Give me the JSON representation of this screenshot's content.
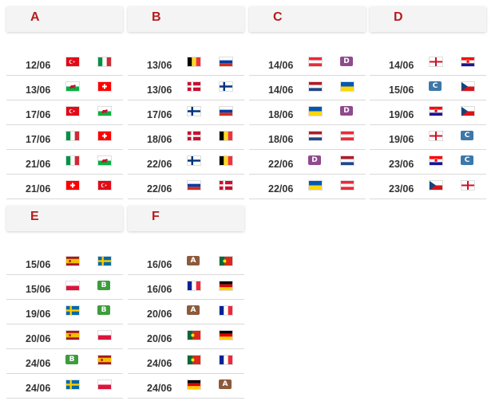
{
  "groups": [
    {
      "letter": "A",
      "matches": [
        {
          "date": "12/06",
          "t1": "turkey",
          "t2": "italy"
        },
        {
          "date": "13/06",
          "t1": "wales",
          "t2": "switzerland"
        },
        {
          "date": "17/06",
          "t1": "turkey",
          "t2": "wales"
        },
        {
          "date": "17/06",
          "t1": "italy",
          "t2": "switzerland"
        },
        {
          "date": "21/06",
          "t1": "italy",
          "t2": "wales"
        },
        {
          "date": "21/06",
          "t1": "switzerland",
          "t2": "turkey"
        }
      ]
    },
    {
      "letter": "B",
      "matches": [
        {
          "date": "13/06",
          "t1": "belgium",
          "t2": "russia"
        },
        {
          "date": "13/06",
          "t1": "denmark",
          "t2": "finland"
        },
        {
          "date": "17/06",
          "t1": "finland",
          "t2": "russia"
        },
        {
          "date": "18/06",
          "t1": "denmark",
          "t2": "belgium"
        },
        {
          "date": "22/06",
          "t1": "finland",
          "t2": "belgium"
        },
        {
          "date": "22/06",
          "t1": "russia",
          "t2": "denmark"
        }
      ]
    },
    {
      "letter": "C",
      "matches": [
        {
          "date": "14/06",
          "t1": "austria",
          "t2": "D"
        },
        {
          "date": "14/06",
          "t1": "netherlands",
          "t2": "ukraine"
        },
        {
          "date": "18/06",
          "t1": "ukraine",
          "t2": "D"
        },
        {
          "date": "18/06",
          "t1": "netherlands",
          "t2": "austria"
        },
        {
          "date": "22/06",
          "t1": "D",
          "t2": "netherlands"
        },
        {
          "date": "22/06",
          "t1": "ukraine",
          "t2": "austria"
        }
      ]
    },
    {
      "letter": "D",
      "matches": [
        {
          "date": "14/06",
          "t1": "england",
          "t2": "croatia"
        },
        {
          "date": "15/06",
          "t1": "C",
          "t2": "czech"
        },
        {
          "date": "19/06",
          "t1": "croatia",
          "t2": "czech"
        },
        {
          "date": "19/06",
          "t1": "england",
          "t2": "C"
        },
        {
          "date": "23/06",
          "t1": "croatia",
          "t2": "C"
        },
        {
          "date": "23/06",
          "t1": "czech",
          "t2": "england"
        }
      ]
    },
    {
      "letter": "E",
      "matches": [
        {
          "date": "15/06",
          "t1": "spain",
          "t2": "sweden"
        },
        {
          "date": "15/06",
          "t1": "poland",
          "t2": "B"
        },
        {
          "date": "19/06",
          "t1": "sweden",
          "t2": "B"
        },
        {
          "date": "20/06",
          "t1": "spain",
          "t2": "poland"
        },
        {
          "date": "24/06",
          "t1": "B",
          "t2": "spain"
        },
        {
          "date": "24/06",
          "t1": "sweden",
          "t2": "poland"
        }
      ]
    },
    {
      "letter": "F",
      "matches": [
        {
          "date": "16/06",
          "t1": "A",
          "t2": "portugal"
        },
        {
          "date": "16/06",
          "t1": "france",
          "t2": "germany"
        },
        {
          "date": "20/06",
          "t1": "A",
          "t2": "france"
        },
        {
          "date": "20/06",
          "t1": "portugal",
          "t2": "germany"
        },
        {
          "date": "24/06",
          "t1": "portugal",
          "t2": "france"
        },
        {
          "date": "24/06",
          "t1": "germany",
          "t2": "A"
        }
      ]
    }
  ],
  "colors": {
    "accent": "#b71c1c",
    "badge_A": "#8d5a3b",
    "badge_B": "#3d9c3d",
    "badge_C": "#3c78a8",
    "badge_D": "#8e4a8e"
  }
}
